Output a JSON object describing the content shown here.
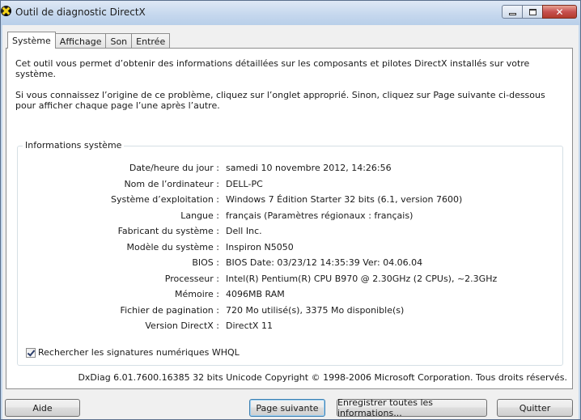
{
  "window": {
    "title": "Outil de diagnostic DirectX",
    "caption_buttons": {
      "minimize": "minimize-icon",
      "maximize": "maximize-icon",
      "close": "close-icon"
    }
  },
  "tabs": [
    {
      "label": "Système",
      "active": true
    },
    {
      "label": "Affichage",
      "active": false
    },
    {
      "label": "Son",
      "active": false
    },
    {
      "label": "Entrée",
      "active": false
    }
  ],
  "intro": {
    "line1": "Cet outil vous permet d’obtenir des informations détaillées sur les composants et pilotes DirectX installés sur votre système.",
    "line2": "Si vous connaissez l’origine de ce problème, cliquez sur l’onglet approprié. Sinon, cliquez sur Page suivante ci-dessous pour afficher chaque page l’une après l’autre."
  },
  "system_info": {
    "group_label": "Informations système",
    "rows": [
      {
        "label": "Date/heure du jour :",
        "value": "samedi 10 novembre 2012, 14:26:56"
      },
      {
        "label": "Nom de l’ordinateur :",
        "value": "DELL-PC"
      },
      {
        "label": "Système d’exploitation :",
        "value": "Windows 7 Édition Starter 32 bits (6.1, version 7600)"
      },
      {
        "label": "Langue :",
        "value": "français (Paramètres régionaux : français)"
      },
      {
        "label": "Fabricant du système :",
        "value": "Dell Inc."
      },
      {
        "label": "Modèle du système :",
        "value": "Inspiron N5050"
      },
      {
        "label": "BIOS :",
        "value": "BIOS Date: 03/23/12 14:35:39 Ver: 04.06.04"
      },
      {
        "label": "Processeur :",
        "value": "Intel(R) Pentium(R) CPU B970 @ 2.30GHz (2 CPUs), ~2.3GHz"
      },
      {
        "label": "Mémoire :",
        "value": "4096MB RAM"
      },
      {
        "label": "Fichier de pagination :",
        "value": "720 Mo utilisé(s), 3375 Mo disponible(s)"
      },
      {
        "label": "Version DirectX :",
        "value": "DirectX 11"
      }
    ],
    "whql_checkbox": {
      "label": "Rechercher les signatures numériques WHQL",
      "checked": true
    }
  },
  "footer": {
    "copyright": "DxDiag 6.01.7600.16385 32 bits Unicode Copyright © 1998-2006 Microsoft Corporation. Tous droits réservés."
  },
  "buttons": {
    "help": "Aide",
    "next_page": "Page suivante",
    "save_all": "Enregistrer toutes les informations...",
    "quit": "Quitter"
  }
}
